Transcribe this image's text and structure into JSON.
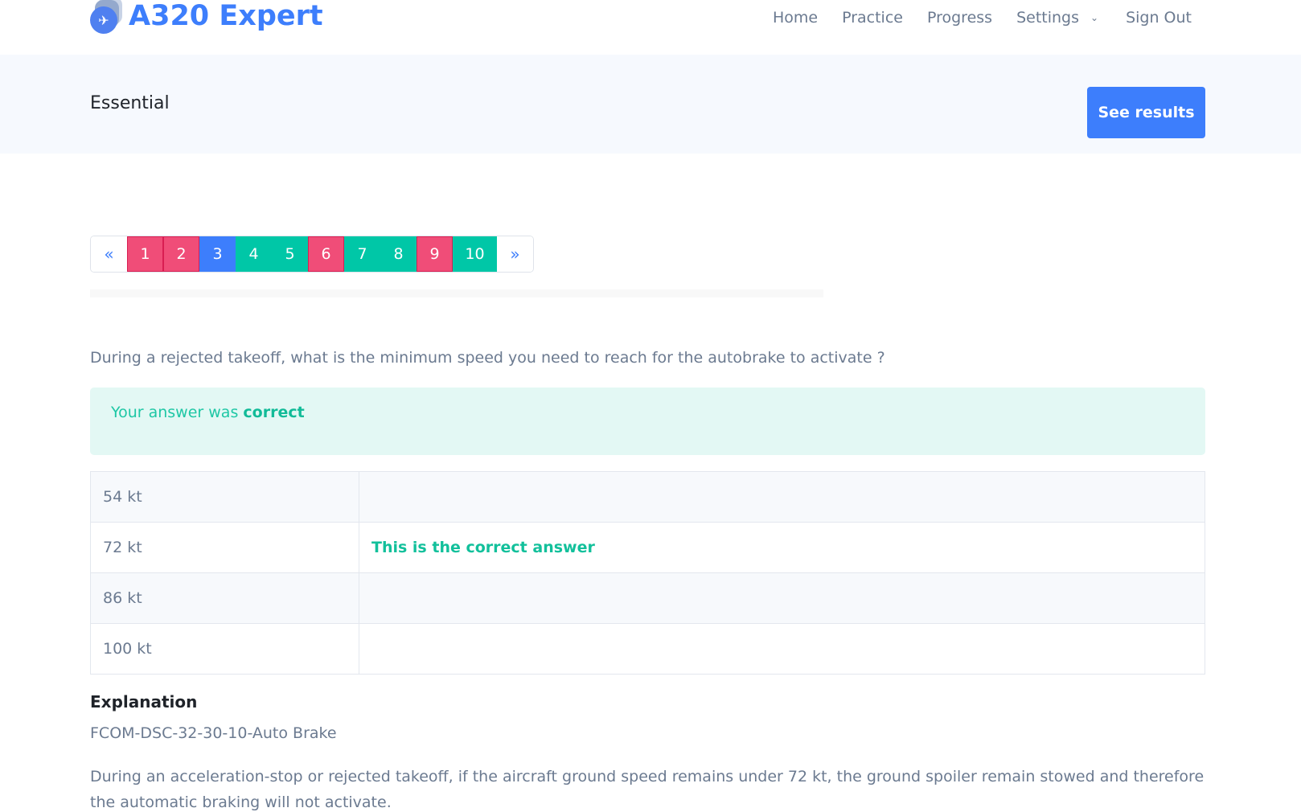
{
  "nav": {
    "brand": "A320 Expert",
    "brand_icon": "airplane-icon",
    "links": [
      {
        "label": "Home"
      },
      {
        "label": "Practice"
      },
      {
        "label": "Progress"
      },
      {
        "label": "Settings",
        "has_dropdown": true
      },
      {
        "label": "Sign Out"
      }
    ]
  },
  "hero": {
    "title": "Essential",
    "see_results_label": "See results"
  },
  "pagination": {
    "prev": "«",
    "next": "»",
    "current": 3,
    "pages": [
      {
        "label": "1",
        "status": "wrong"
      },
      {
        "label": "2",
        "status": "wrong"
      },
      {
        "label": "3",
        "status": "current"
      },
      {
        "label": "4",
        "status": "correct"
      },
      {
        "label": "5",
        "status": "correct"
      },
      {
        "label": "6",
        "status": "wrong"
      },
      {
        "label": "7",
        "status": "correct"
      },
      {
        "label": "8",
        "status": "correct"
      },
      {
        "label": "9",
        "status": "wrong"
      },
      {
        "label": "10",
        "status": "correct"
      }
    ],
    "colors": {
      "wrong": "#f04d78",
      "correct": "#00c7a7",
      "current": "#3d7efc"
    }
  },
  "question": {
    "text": "During a rejected takeoff, what is the minimum speed you need to reach for the autobrake to activate ?"
  },
  "result": {
    "prefix": "Your answer was ",
    "verdict": "correct"
  },
  "answers": [
    {
      "option": "54 kt",
      "feedback": ""
    },
    {
      "option": "72 kt",
      "feedback": "This is the correct answer"
    },
    {
      "option": "86 kt",
      "feedback": ""
    },
    {
      "option": "100 kt",
      "feedback": ""
    }
  ],
  "explanation": {
    "title": "Explanation",
    "reference": "FCOM-DSC-32-30-10-Auto Brake",
    "body": "During an acceleration-stop or rejected takeoff, if the aircraft ground speed remains under 72 kt, the ground spoiler remain stowed and therefore the automatic braking will not activate."
  }
}
